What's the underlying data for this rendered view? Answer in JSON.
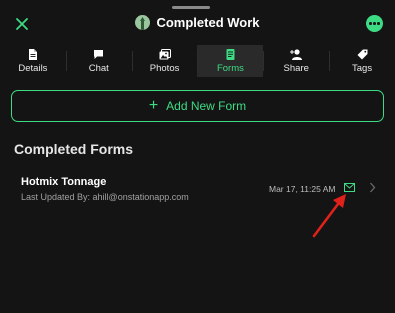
{
  "header": {
    "title": "Completed Work",
    "close_icon": "close-icon",
    "more_icon": "more-icon"
  },
  "tabs": [
    {
      "label": "Details",
      "icon": "document-icon",
      "active": false
    },
    {
      "label": "Chat",
      "icon": "chat-bubble-icon",
      "active": false
    },
    {
      "label": "Photos",
      "icon": "photos-icon",
      "active": false
    },
    {
      "label": "Forms",
      "icon": "form-icon",
      "active": true
    },
    {
      "label": "Share",
      "icon": "add-person-icon",
      "active": false
    },
    {
      "label": "Tags",
      "icon": "tag-icon",
      "active": false
    }
  ],
  "add_form": {
    "label": "Add New Form"
  },
  "completed_forms": {
    "title": "Completed Forms",
    "items": [
      {
        "name": "Hotmix Tonnage",
        "updated": "Last Updated By: ahill@onstationapp.com",
        "date": "Mar 17, 11:25 AM"
      }
    ]
  },
  "colors": {
    "accent": "#3ddc84",
    "background": "#141414",
    "annotation_arrow": "#e0211b"
  }
}
